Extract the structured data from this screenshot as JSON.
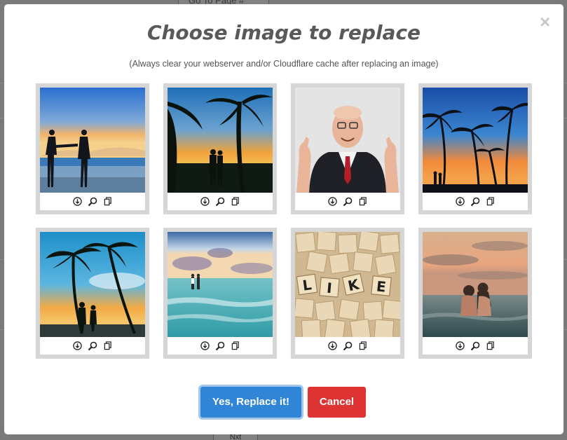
{
  "background": {
    "goto_label": "Go To Page #",
    "next_label": "Nxt"
  },
  "modal": {
    "title": "Choose image to replace",
    "subtitle": "(Always clear your webserver and/or Cloudflare cache after replacing an image)",
    "close_glyph": "×",
    "confirm_label": "Yes, Replace it!",
    "cancel_label": "Cancel",
    "confirm_color": "#3085d6",
    "cancel_color": "#dd3333"
  },
  "images": [
    {
      "subject": "couple-beach-sunset-photo"
    },
    {
      "subject": "couple-palm-trees-sunset-photo"
    },
    {
      "subject": "old-man-thumbs-up-photo"
    },
    {
      "subject": "palm-trees-silhouette-sunset-photo"
    },
    {
      "subject": "couple-under-palms-blue-sky-photo"
    },
    {
      "subject": "couple-in-sea-photo"
    },
    {
      "subject": "scrabble-tiles-like-photo"
    },
    {
      "subject": "couple-in-ocean-dusk-photo"
    }
  ],
  "tools": [
    "download-icon",
    "zoom-icon",
    "copy-icon"
  ]
}
